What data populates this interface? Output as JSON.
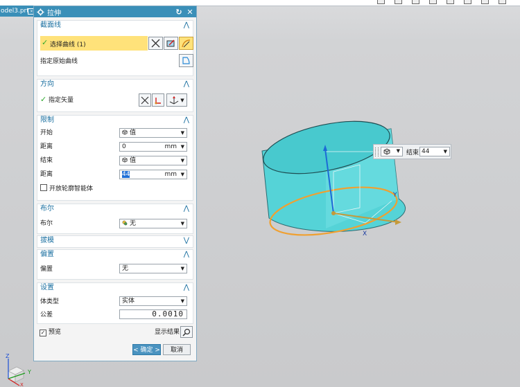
{
  "file_tab": {
    "label": "odel3.prt"
  },
  "dialog": {
    "title": "拉伸",
    "sections": {
      "section_curve": {
        "header": "截面线",
        "select_curve": "选择曲线 (1)",
        "specify_original": "指定原始曲线"
      },
      "direction": {
        "header": "方向",
        "specify_vector": "指定矢量"
      },
      "limits": {
        "header": "限制",
        "start_label": "开始",
        "start_value": "值",
        "start_distance_label": "距离",
        "start_distance": "0",
        "end_label": "结束",
        "end_value": "值",
        "end_distance_label": "距离",
        "end_distance": "44",
        "unit": "mm",
        "open_profile": "开放轮廓智能体"
      },
      "boolean": {
        "header": "布尔",
        "label": "布尔",
        "value": "无"
      },
      "draft": {
        "header": "拔模"
      },
      "offset": {
        "header": "偏置",
        "label": "偏置",
        "value": "无"
      },
      "settings": {
        "header": "设置",
        "body_type_label": "体类型",
        "body_type": "实体",
        "tolerance_label": "公差",
        "tolerance": "0.0010"
      }
    },
    "preview_label": "预览",
    "show_result": "显示结果",
    "ok": "< 确定 >",
    "cancel": "取消"
  },
  "viewport": {
    "float_label": "结束",
    "float_value": "44",
    "axes": {
      "x": "X",
      "y": "Y",
      "z": "Z"
    }
  },
  "colors": {
    "accent": "#3a8fb8",
    "cylinder": "#5fd8dc",
    "highlight": "#ffe27a",
    "edge": "#f0a030"
  }
}
